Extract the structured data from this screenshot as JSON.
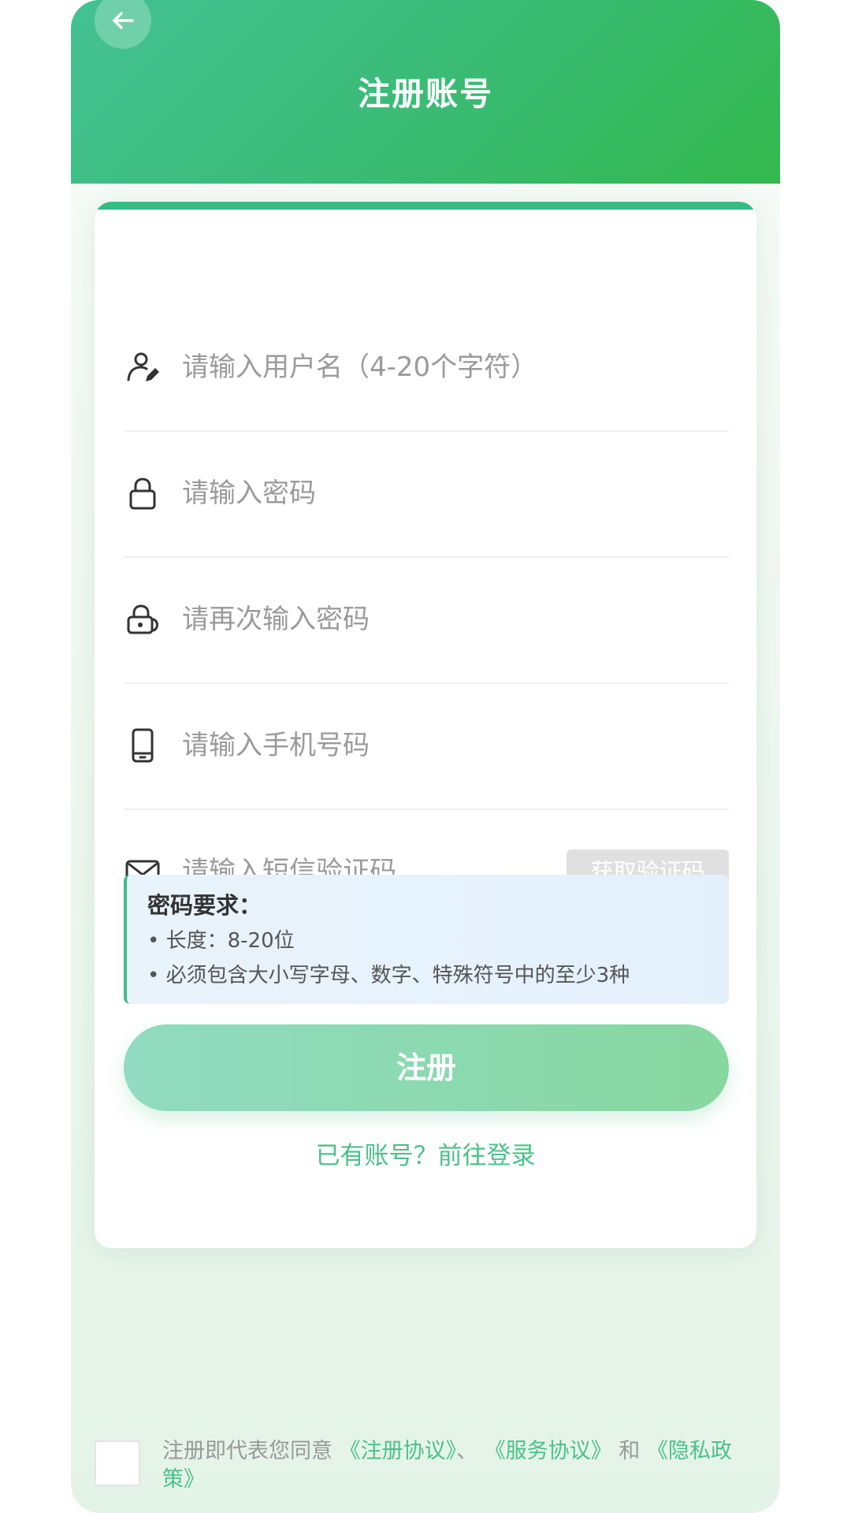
{
  "header": {
    "title": "注册账号",
    "back_icon": "arrow-left-icon"
  },
  "form": {
    "username": {
      "placeholder": "请输入用户名（4-20个字符）",
      "value": "",
      "icon": "user-edit-icon"
    },
    "password": {
      "placeholder": "请输入密码",
      "value": "",
      "icon": "lock-icon"
    },
    "confirm_password": {
      "placeholder": "请再次输入密码",
      "value": "",
      "icon": "lock-check-icon"
    },
    "phone": {
      "placeholder": "请输入手机号码",
      "value": "",
      "icon": "phone-icon"
    },
    "sms_code": {
      "placeholder": "请输入短信验证码",
      "value": "",
      "icon": "mail-icon"
    },
    "get_code_label": "获取验证码"
  },
  "requirements": {
    "title": "密码要求：",
    "lines": [
      "• 长度：8-20位",
      "• 必须包含大小写字母、数字、特殊符号中的至少3种"
    ]
  },
  "submit_label": "注册",
  "login_link": "已有账号？前往登录",
  "agreement": {
    "prefix": "注册即代表您同意",
    "link1": "《注册协议》",
    "sep": "、",
    "link2": "《服务协议》",
    "and": "和",
    "link3": "《隐私政策》",
    "checked": false
  },
  "colors": {
    "header_start": "#43c194",
    "header_end": "#33b84d",
    "accent": "#4cc08a",
    "button_start": "#90dbc2",
    "button_end": "#87d7a0"
  }
}
